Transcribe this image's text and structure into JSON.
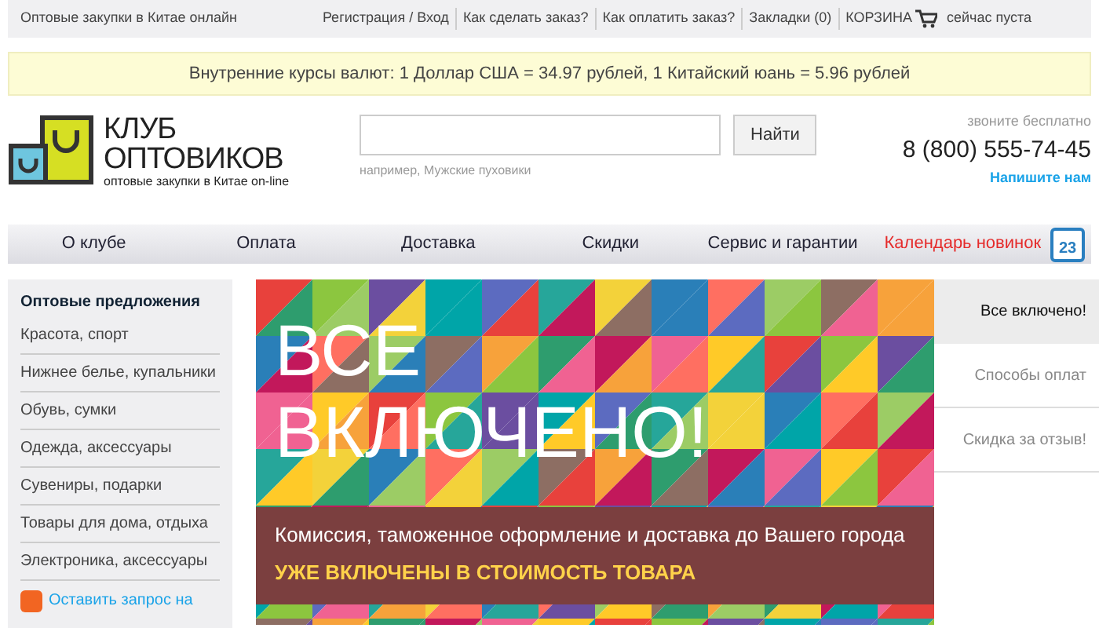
{
  "top_bar": {
    "tagline": "Оптовые закупки в Китае онлайн",
    "links": [
      "Регистрация / Вход",
      "Как сделать заказ?",
      "Как оплатить заказ?",
      "Закладки (0)"
    ],
    "cart": {
      "label": "КОРЗИНА",
      "status": "сейчас пуста"
    }
  },
  "rates_notice": "Внутренние курсы валют: 1 Доллар США = 34.97 рублей, 1 Китайский юань = 5.96 рублей",
  "logo": {
    "line_1": "КЛУБ",
    "line_2": "ОПТОВИКОВ",
    "subtitle": "оптовые закупки в Китае on-line"
  },
  "search": {
    "button": "Найти",
    "example": "например, Мужские пуховики"
  },
  "contact": {
    "caption": "звоните бесплатно",
    "phone": "8 (800) 555-74-45",
    "write_link": "Напишите нам"
  },
  "nav": {
    "items": [
      "О клубе",
      "Оплата",
      "Доставка",
      "Скидки",
      "Сервис и гарантии"
    ],
    "calendar_link": {
      "label": "Календарь новинок",
      "day": "23"
    }
  },
  "sidebar": {
    "heading": "Оптовые предложения",
    "items": [
      "Красота, спорт",
      "Нижнее белье, купальники",
      "Обувь, сумки",
      "Одежда, аксессуары",
      "Сувениры, подарки",
      "Товары для дома, отдыха",
      "Электроника, аксессуары"
    ],
    "request_link": "Оставить запрос на"
  },
  "banner": {
    "headline_1": "ВСЕ",
    "headline_2": "ВКЛЮЧЕНО!",
    "caption": "Комиссия, таможенное оформление и доставка до Вашего города",
    "caption_bold": "УЖЕ ВКЛЮЧЕНЫ В СТОИМОСТЬ ТОВАРА"
  },
  "banner_tabs": [
    {
      "label": "Все включено!",
      "selected": true
    },
    {
      "label": "Способы оплат",
      "selected": false
    },
    {
      "label": "Скидка за отзыв!",
      "selected": false
    }
  ]
}
